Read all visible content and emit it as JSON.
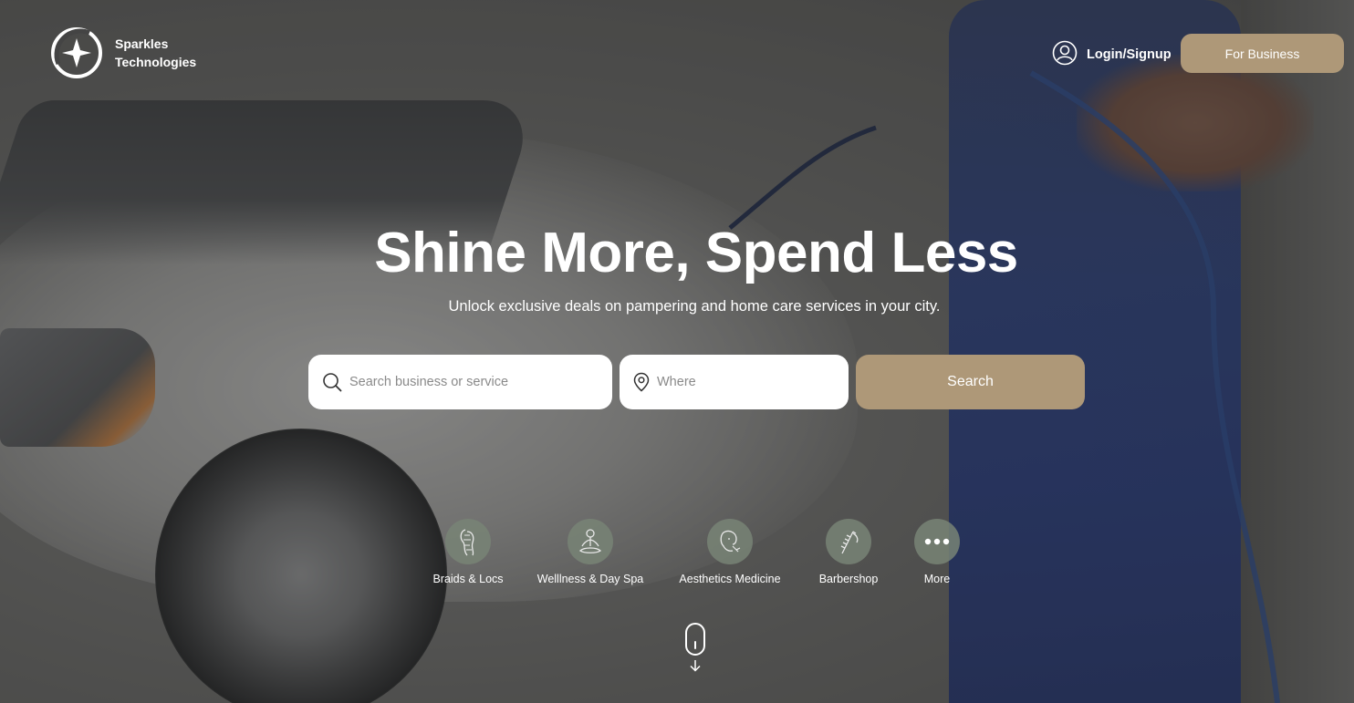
{
  "brand": {
    "line1": "Sparkles",
    "line2": "Technologies"
  },
  "header": {
    "login_label": "Login/Signup",
    "business_label": "For Business"
  },
  "hero": {
    "title": "Shine More, Spend Less",
    "subtitle": "Unlock exclusive deals on pampering and home care services in your city."
  },
  "search": {
    "what_placeholder": "Search business or service",
    "where_placeholder": "Where",
    "button_label": "Search"
  },
  "categories": [
    {
      "label": "Braids & Locs",
      "icon": "braids-icon"
    },
    {
      "label": "Welllness & Day Spa",
      "icon": "meditation-icon"
    },
    {
      "label": "Aesthetics Medicine",
      "icon": "face-icon"
    },
    {
      "label": "Barbershop",
      "icon": "razor-icon"
    },
    {
      "label": "More",
      "icon": "more-dots-icon"
    }
  ],
  "colors": {
    "accent": "#ae9878",
    "category_circle": "#788476"
  }
}
